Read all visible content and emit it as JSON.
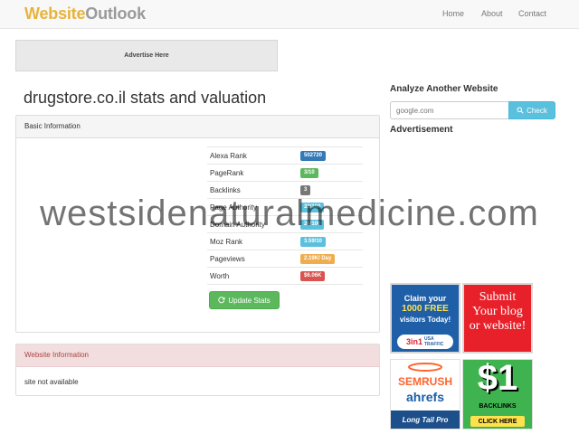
{
  "brand": {
    "part1": "Website",
    "part2": "Outlook"
  },
  "nav": {
    "home": "Home",
    "about": "About",
    "contact": "Contact"
  },
  "ad_top": "Advertise Here",
  "page_title": "drugstore.co.il stats and valuation",
  "basic_info": {
    "heading": "Basic Information",
    "stats": [
      {
        "label": "Alexa Rank",
        "value": "502720",
        "color": "#337ab7"
      },
      {
        "label": "PageRank",
        "value": "3/10",
        "color": "#5cb85c"
      },
      {
        "label": "Backlinks",
        "value": "3",
        "color": "#777777"
      },
      {
        "label": "Page Authority",
        "value": "33/100",
        "color": "#5bc0de"
      },
      {
        "label": "Domain Authority",
        "value": "24/100",
        "color": "#5bc0de"
      },
      {
        "label": "Moz Rank",
        "value": "3.59/10",
        "color": "#5bc0de"
      },
      {
        "label": "Pageviews",
        "value": "2.19K/ Day",
        "color": "#f0ad4e"
      },
      {
        "label": "Worth",
        "value": "$6.06K",
        "color": "#d9534f"
      }
    ],
    "update_button": "Update Stats"
  },
  "website_info": {
    "heading": "Website Information",
    "body": "site not available"
  },
  "sidebar": {
    "analyze_title": "Analyze Another Website",
    "search_placeholder": "google.com",
    "check_button": "Check",
    "ad_title": "Advertisement"
  },
  "ads": {
    "ad1_line1": "Claim your",
    "ad1_line2": "1000 FREE",
    "ad1_line3": "visitors Today!",
    "ad1_logo": "3in1",
    "ad1_logo_sub": "USA TRAFFIC",
    "ad2_text": "Submit Your blog or website!",
    "ad3_brand1": "SEMRUSH",
    "ad3_brand2": "ahrefs",
    "ad3_brand3": "Long Tail Pro",
    "ad4_big": "$1",
    "ad4_mid": "BACKLINKS",
    "ad4_btn": "CLICK HERE"
  },
  "watermark": "westsidenaturalmedicine.com"
}
